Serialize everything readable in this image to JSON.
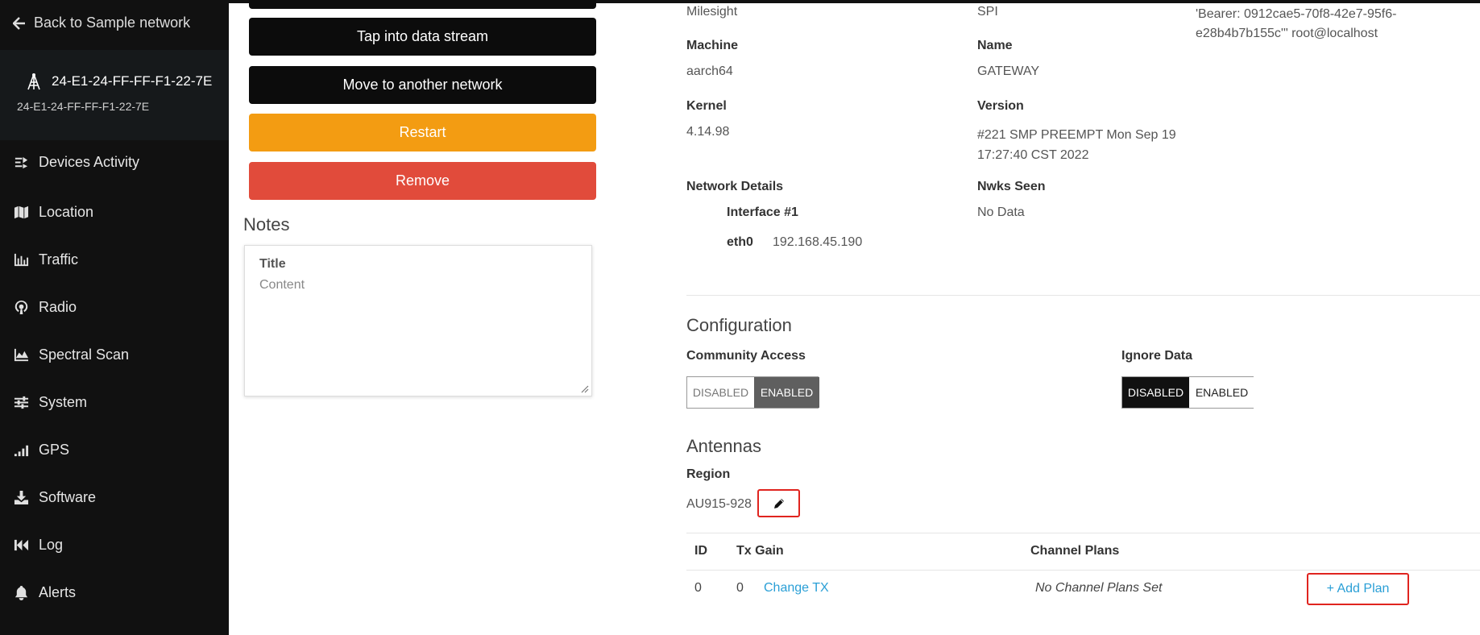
{
  "sidebar": {
    "back_label": "Back to Sample network",
    "gateway_title": "24-E1-24-FF-FF-F1-22-7E",
    "gateway_subtitle": "24-E1-24-FF-FF-F1-22-7E",
    "items": [
      {
        "label": "Devices Activity",
        "icon": "devices-activity-icon"
      },
      {
        "label": "Location",
        "icon": "map-icon"
      },
      {
        "label": "Traffic",
        "icon": "bar-chart-icon"
      },
      {
        "label": "Radio",
        "icon": "radio-icon"
      },
      {
        "label": "Spectral Scan",
        "icon": "area-chart-icon"
      },
      {
        "label": "System",
        "icon": "sliders-icon"
      },
      {
        "label": "GPS",
        "icon": "signal-icon"
      },
      {
        "label": "Software",
        "icon": "download-icon"
      },
      {
        "label": "Log",
        "icon": "rewind-icon"
      },
      {
        "label": "Alerts",
        "icon": "bell-icon"
      }
    ]
  },
  "actions": {
    "tap_stream": "Tap into data stream",
    "move_network": "Move to another network",
    "restart": "Restart",
    "remove": "Remove"
  },
  "notes": {
    "heading": "Notes",
    "title_placeholder": "Title",
    "content_placeholder": "Content"
  },
  "system": {
    "vendor": "Milesight",
    "interface_type": "SPI",
    "auth_value": "'Bearer: 0912cae5-70f8-42e7-95f6-e28b4b7b155c'\" root@localhost",
    "machine_label": "Machine",
    "machine_value": "aarch64",
    "name_label": "Name",
    "name_value": "GATEWAY",
    "kernel_label": "Kernel",
    "kernel_value": "4.14.98",
    "version_label": "Version",
    "version_value": "#221 SMP PREEMPT Mon Sep 19 17:27:40 CST 2022",
    "network_details_label": "Network Details",
    "interface_label": "Interface #1",
    "iface_name": "eth0",
    "iface_ip": "192.168.45.190",
    "nwks_seen_label": "Nwks Seen",
    "nwks_seen_value": "No Data"
  },
  "configuration": {
    "heading": "Configuration",
    "community_access_label": "Community Access",
    "community_access_options": [
      "DISABLED",
      "ENABLED"
    ],
    "community_access_selected": "ENABLED",
    "ignore_data_label": "Ignore Data",
    "ignore_data_options": [
      "DISABLED",
      "ENABLED"
    ],
    "ignore_data_selected": "DISABLED"
  },
  "antennas": {
    "heading": "Antennas",
    "region_label": "Region",
    "region_value": "AU915-928",
    "columns": [
      "ID",
      "Tx Gain",
      "Channel Plans"
    ],
    "rows": [
      {
        "id": "0",
        "tx_gain": "0",
        "change_tx": "Change TX",
        "channel_plans": "No Channel Plans Set",
        "add_plan": "+ Add Plan"
      }
    ]
  },
  "colors": {
    "sidebar_bg": "#111111",
    "orange": "#f39c12",
    "red": "#e14b3b",
    "link": "#2a9fd6",
    "highlight": "#e0241f"
  }
}
